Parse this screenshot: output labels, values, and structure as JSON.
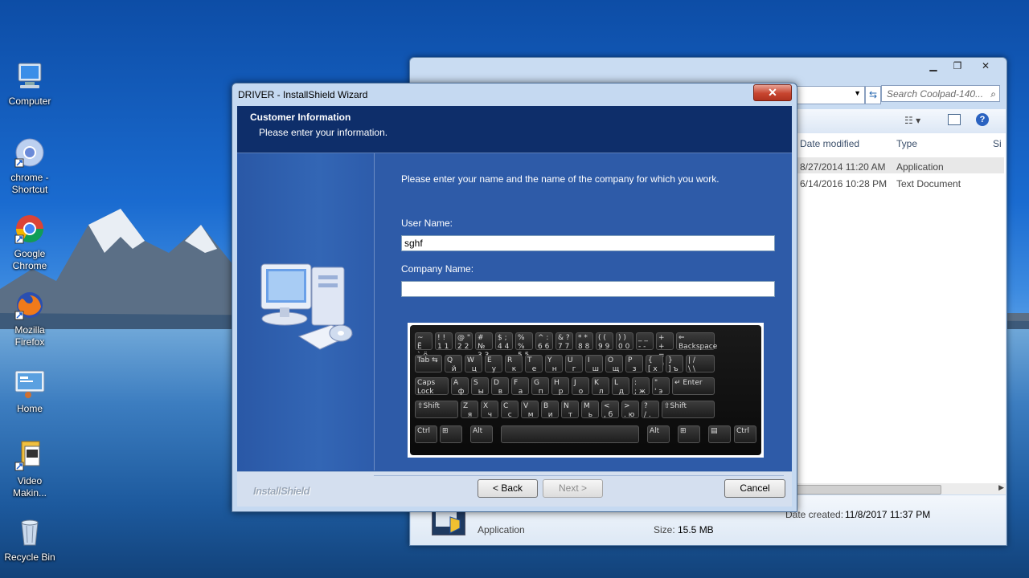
{
  "desktop": {
    "icons": [
      {
        "label": "Computer",
        "icon": "computer-icon"
      },
      {
        "label": "chrome - Shortcut",
        "icon": "chrome-icon"
      },
      {
        "label": "Google Chrome",
        "icon": "chrome-icon"
      },
      {
        "label": "Mozilla Firefox",
        "icon": "firefox-icon"
      },
      {
        "label": "Home",
        "icon": "home-icon"
      },
      {
        "label": "Video Makin...",
        "icon": "video-maker-icon"
      },
      {
        "label": "Recycle Bin",
        "icon": "recycle-bin-icon"
      }
    ]
  },
  "explorer": {
    "search_placeholder": "Search Coolpad-140...",
    "columns": {
      "date_modified": "Date modified",
      "type": "Type",
      "size": "Si"
    },
    "files": [
      {
        "date": "8/27/2014 11:20 AM",
        "type": "Application"
      },
      {
        "date": "6/14/2016 10:28 PM",
        "type": "Text Document"
      }
    ],
    "details": {
      "type": "Application",
      "date_created_label": "Date created:",
      "date_created": "11/8/2017 11:37 PM",
      "size_label": "Size:",
      "size": "15.5 MB"
    }
  },
  "wizard": {
    "title": "DRIVER - InstallShield Wizard",
    "close_glyph": "✕",
    "header_title": "Customer Information",
    "header_subtitle": "Please enter your information.",
    "instruction": "Please enter your name and the name of the company for which you work.",
    "user_name_label": "User Name:",
    "user_name_value": "sghf",
    "company_name_label": "Company Name:",
    "company_name_value": "",
    "brand": "InstallShield",
    "back_label": "< Back",
    "next_label": "Next >",
    "cancel_label": "Cancel"
  },
  "colors": {
    "wizard_header": "#0e2e6a",
    "wizard_body": "#2e5ba8",
    "close_button": "#c7452f"
  }
}
